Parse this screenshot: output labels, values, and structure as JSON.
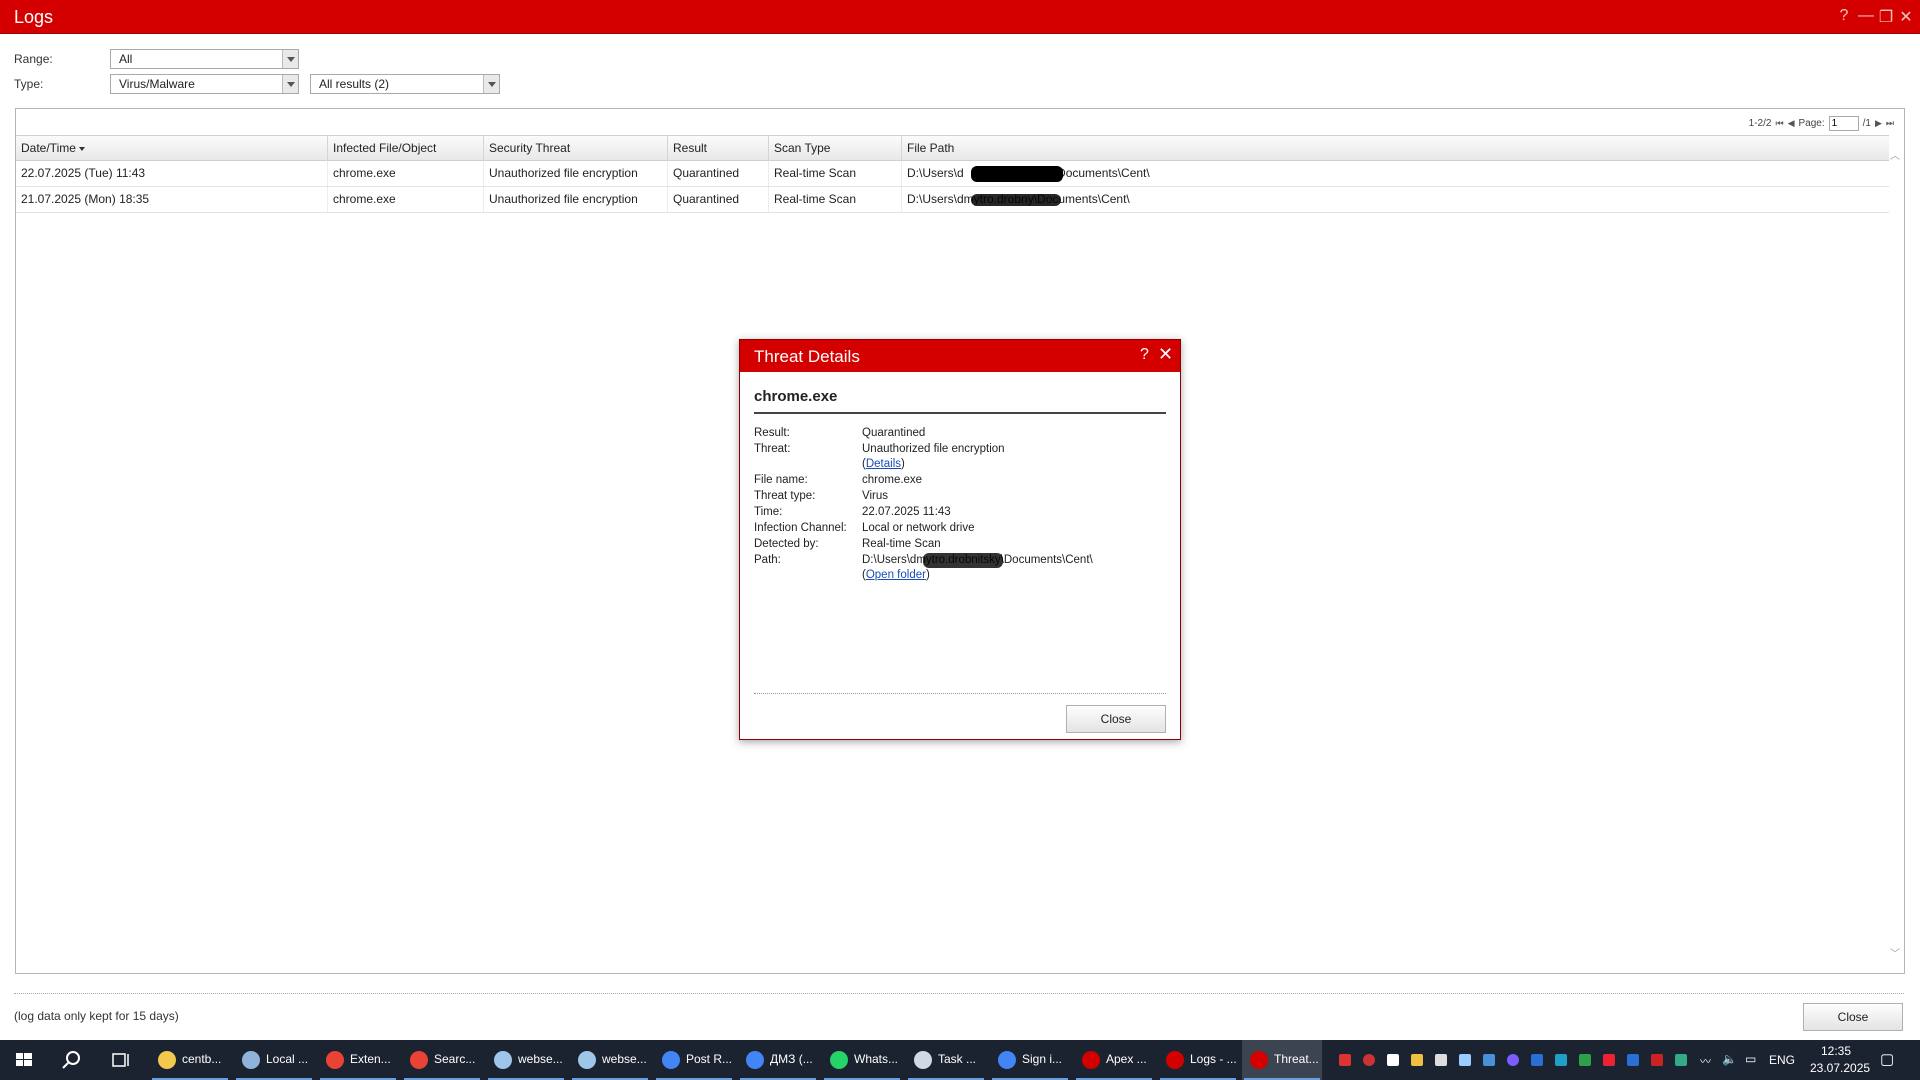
{
  "window": {
    "title": "Logs",
    "controls": [
      "?",
      "—",
      "❐",
      "✕"
    ]
  },
  "filters": {
    "range_label": "Range:",
    "range_value": "All",
    "type_label": "Type:",
    "type_value": "Virus/Malware",
    "results_value": "All results (2)"
  },
  "pager": {
    "summary": "1-2/2",
    "page_label": "Page:",
    "page_value": "1",
    "total": "/1"
  },
  "table": {
    "columns": [
      "Date/Time",
      "Infected File/Object",
      "Security Threat",
      "Result",
      "Scan Type",
      "File Path"
    ],
    "rows": [
      {
        "datetime": "22.07.2025 (Tue) 11:43",
        "file": "chrome.exe",
        "threat": "Unauthorized file encryption",
        "result": "Quarantined",
        "scan": "Real-time Scan",
        "path_start": "D:\\Users\\d",
        "path_end": "\\Documents\\Cent\\"
      },
      {
        "datetime": "21.07.2025 (Mon) 18:35",
        "file": "chrome.exe",
        "threat": "Unauthorized file encryption",
        "result": "Quarantined",
        "scan": "Real-time Scan",
        "path_start": "D:\\Users\\dmytro.drobn",
        "path_end": "y\\Documents\\Cent\\"
      }
    ]
  },
  "footer": {
    "note": "(log data only kept for 15 days)",
    "close_label": "Close"
  },
  "dialog": {
    "title": "Threat Details",
    "help": "?",
    "close_x": "✕",
    "file": "chrome.exe",
    "labels": {
      "result": "Result:",
      "threat": "Threat:",
      "file_name": "File name:",
      "threat_type": "Threat type:",
      "time": "Time:",
      "channel": "Infection Channel:",
      "detected_by": "Detected by:",
      "path": "Path:"
    },
    "values": {
      "result": "Quarantined",
      "threat": "Unauthorized file encryption",
      "details_link": "Details",
      "file_name": "chrome.exe",
      "threat_type": "Virus",
      "time": "22.07.2025 11:43",
      "channel": "Local or network drive",
      "detected_by": "Real-time Scan",
      "path": "D:\\Users\\dmytro.drobnitsky\\Documents\\Cent\\",
      "open_folder_link": "Open folder"
    },
    "close_label": "Close"
  },
  "taskbar": {
    "apps": [
      {
        "label": "centb...",
        "color": "#f2c94c"
      },
      {
        "label": "Local ...",
        "color": "#8fb3d9"
      },
      {
        "label": "Exten...",
        "color": "#ea4335"
      },
      {
        "label": "Searc...",
        "color": "#ea4335"
      },
      {
        "label": "webse...",
        "color": "#9fc5e8"
      },
      {
        "label": "webse...",
        "color": "#9fc5e8"
      },
      {
        "label": "Post R...",
        "color": "#4285f4"
      },
      {
        "label": "ДМЗ (...",
        "color": "#4285f4"
      },
      {
        "label": "Whats...",
        "color": "#25d366"
      },
      {
        "label": "Task ...",
        "color": "#cfd8e3"
      },
      {
        "label": "Sign i...",
        "color": "#4285f4"
      },
      {
        "label": "Apex ...",
        "color": "#d40000"
      },
      {
        "label": "Logs - ...",
        "color": "#d40000"
      },
      {
        "label": "Threat...",
        "color": "#d40000"
      }
    ],
    "language": "ENG",
    "time": "12:35",
    "date": "23.07.2025"
  }
}
